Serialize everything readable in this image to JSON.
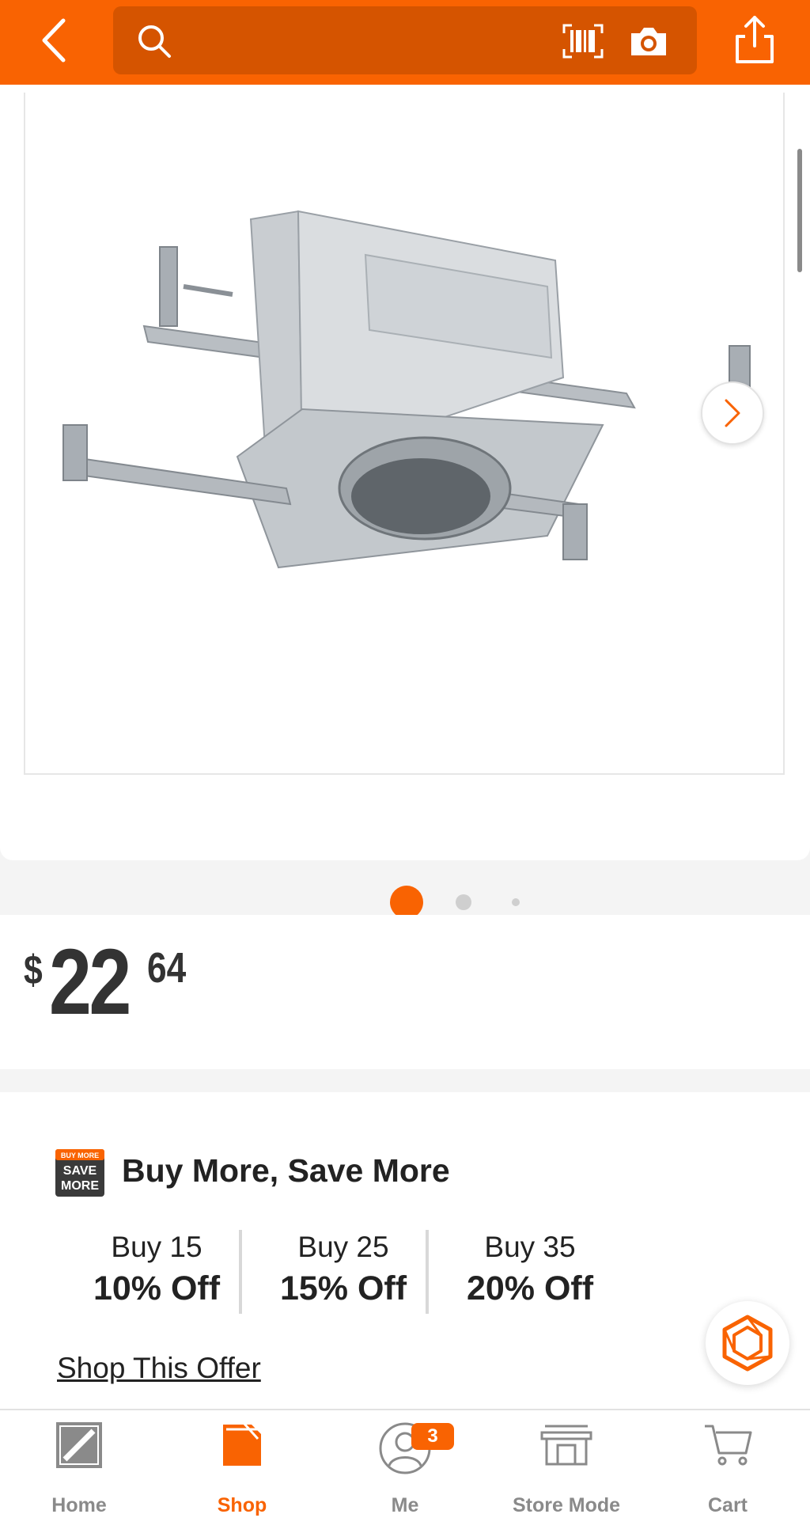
{
  "header": {
    "search_placeholder": "",
    "icons": {
      "back": "chevron-left-icon",
      "search": "search-icon",
      "barcode": "barcode-scan-icon",
      "camera": "camera-icon",
      "share": "share-icon"
    }
  },
  "gallery": {
    "image_count": 3,
    "active_index": 0,
    "next_icon": "chevron-right-icon"
  },
  "price": {
    "currency": "$",
    "dollars": "22",
    "cents": "64"
  },
  "promo": {
    "badge_text": [
      "BUY MORE",
      "SAVE",
      "MORE"
    ],
    "title": "Buy More, Save More",
    "tiers": [
      {
        "qty": "Buy 15",
        "discount": "10% Off"
      },
      {
        "qty": "Buy 25",
        "discount": "15% Off"
      },
      {
        "qty": "Buy 35",
        "discount": "20% Off"
      }
    ],
    "link": "Shop This Offer"
  },
  "nav": {
    "items": [
      {
        "label": "Home",
        "icon": "home-depot-logo-icon"
      },
      {
        "label": "Shop",
        "icon": "shop-tag-icon"
      },
      {
        "label": "Me",
        "icon": "user-icon",
        "badge": "3"
      },
      {
        "label": "Store Mode",
        "icon": "store-icon"
      },
      {
        "label": "Cart",
        "icon": "cart-icon"
      }
    ],
    "active": "Shop"
  },
  "colors": {
    "brand_orange": "#f96302",
    "search_bg": "#d55400",
    "inactive_gray": "#8a8a8a"
  }
}
